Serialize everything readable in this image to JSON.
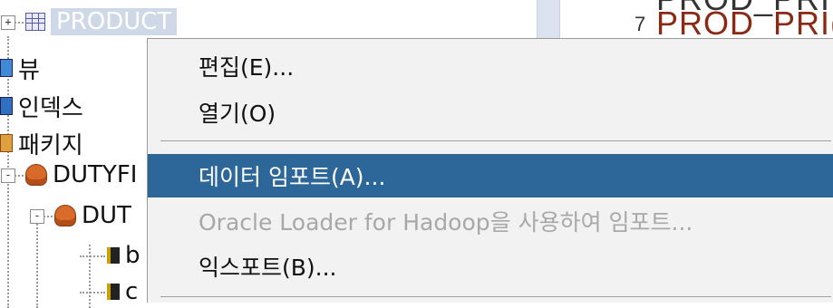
{
  "tree": {
    "items": [
      {
        "label": "PRODUCT",
        "icon": "table-icon"
      },
      {
        "label": "뷰",
        "icon": "view-icon"
      },
      {
        "label": "인덱스",
        "icon": "index-icon"
      },
      {
        "label": "패키지",
        "icon": "package-icon"
      },
      {
        "label": "DUTYFI",
        "icon": "package-body-icon"
      },
      {
        "label": "DUT",
        "icon": "package-body-icon"
      },
      {
        "label": "b",
        "icon": "procedure-icon"
      },
      {
        "label": "c",
        "icon": "procedure-icon"
      }
    ],
    "expander_collapsed": "+",
    "expander_expanded": "-"
  },
  "editor": {
    "line_number": "7",
    "line_text_top": "PROD_PRI",
    "line_text": "PROD_PRI("
  },
  "context_menu": {
    "items": [
      {
        "label": "편집(E)...",
        "state": "normal"
      },
      {
        "label": "열기(O)",
        "state": "normal"
      },
      {
        "label": "데이터 임포트(A)...",
        "state": "active"
      },
      {
        "label": "Oracle Loader for Hadoop을 사용하여 임포트...",
        "state": "disabled"
      },
      {
        "label": "익스포트(B)...",
        "state": "normal"
      }
    ]
  },
  "colors": {
    "menu_bg": "#f2f2f2",
    "active_bg": "#2d6799",
    "disabled_text": "#a8a8a8"
  }
}
